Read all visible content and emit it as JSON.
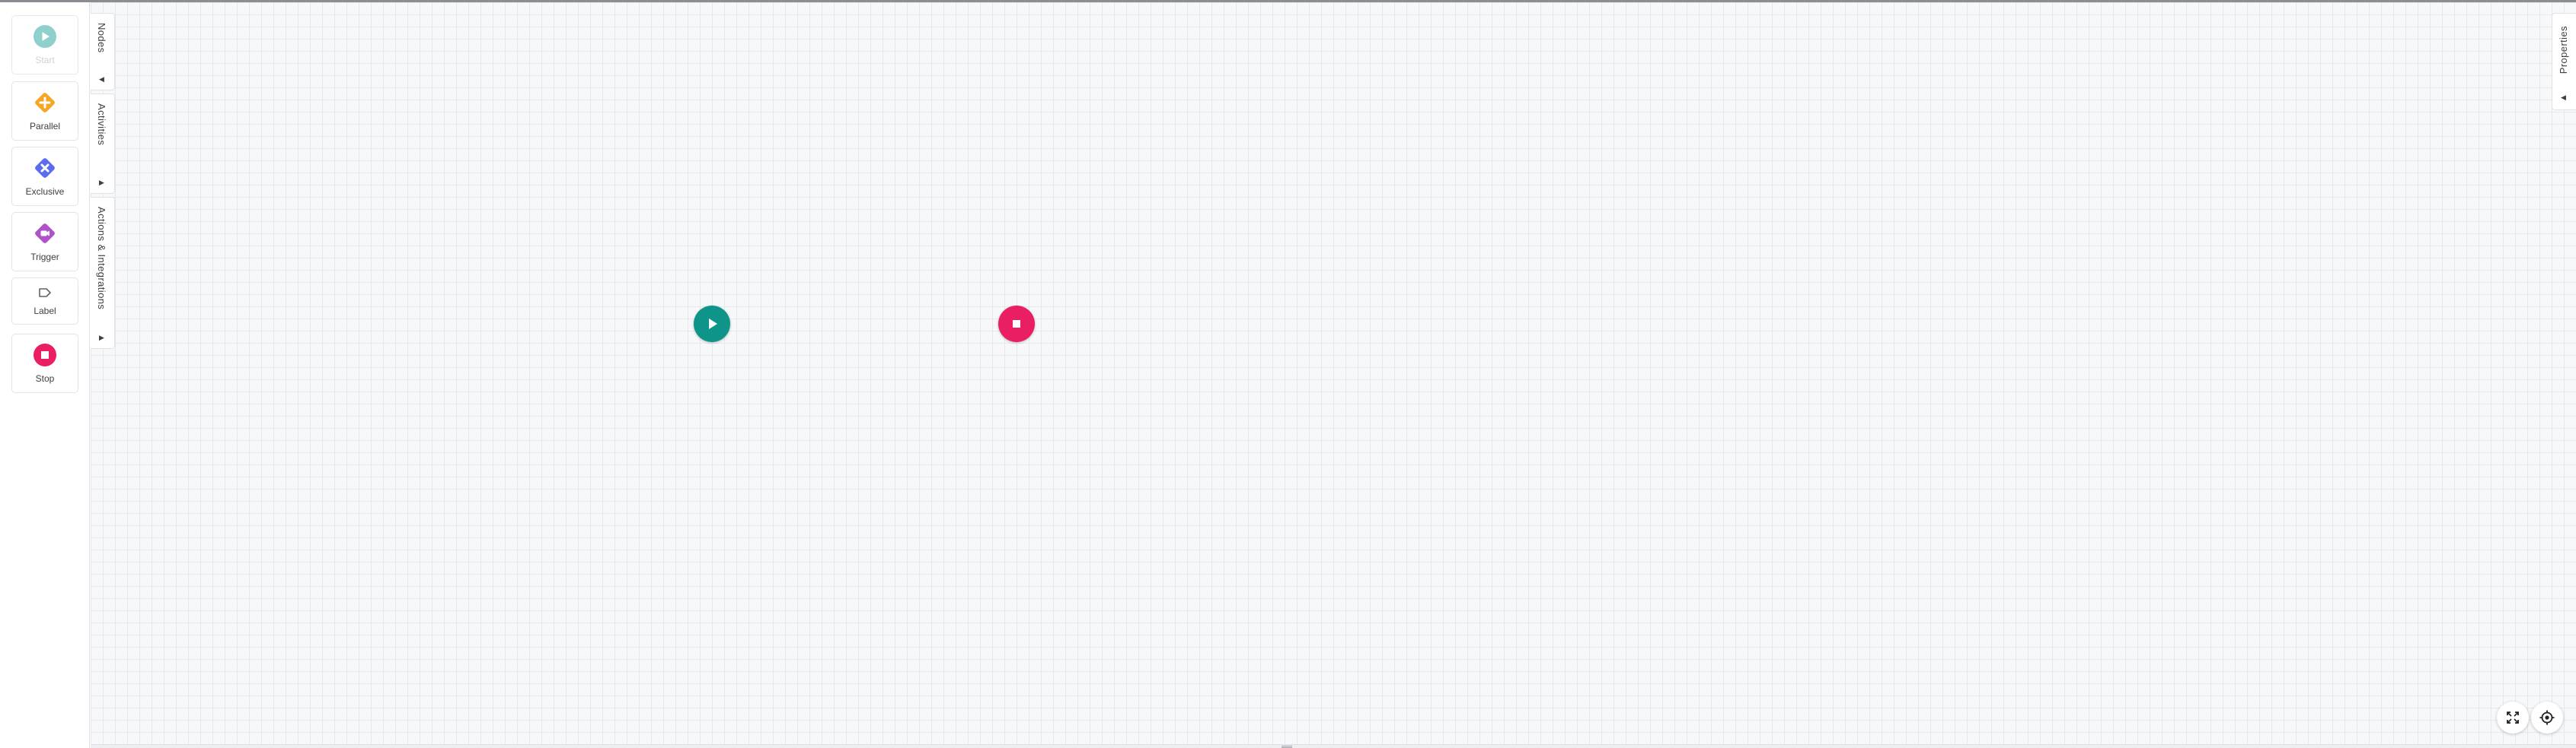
{
  "palette": {
    "items": [
      {
        "label": "Start",
        "icon": "play-icon",
        "color": "#7cc8c4",
        "disabled": true
      },
      {
        "label": "Parallel",
        "icon": "parallel-gateway-icon",
        "color": "#f5a623"
      },
      {
        "label": "Exclusive",
        "icon": "exclusive-gateway-icon",
        "color": "#5b6cf0"
      },
      {
        "label": "Trigger",
        "icon": "trigger-icon",
        "color": "#b053c9"
      },
      {
        "label": "Label",
        "icon": "label-icon",
        "color": "#5f6368"
      },
      {
        "label": "Stop",
        "icon": "stop-icon",
        "color": "#e91e63"
      }
    ]
  },
  "rail": {
    "tabs": [
      {
        "label": "Nodes",
        "arrow": "◀"
      },
      {
        "label": "Activities",
        "arrow": "▶"
      },
      {
        "label": "Actions & Integrations",
        "arrow": "▶"
      }
    ]
  },
  "canvas": {
    "start_node": {
      "icon": "play-icon",
      "color": "#0e9488"
    },
    "stop_node": {
      "icon": "stop-icon",
      "color": "#e91e63"
    }
  },
  "properties": {
    "label": "Properties",
    "arrow": "◀"
  },
  "controls": {
    "fit_icon": "expand-icon",
    "center_icon": "locate-icon"
  }
}
